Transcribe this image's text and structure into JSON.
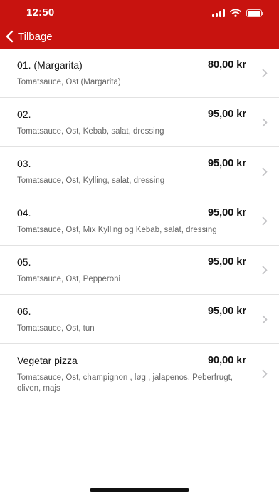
{
  "status": {
    "time": "12:50"
  },
  "nav": {
    "back_label": "Tilbage"
  },
  "items": [
    {
      "number": "01.  (Margarita)",
      "price": "80,00 kr",
      "description": "Tomatsauce, Ost (Margarita)"
    },
    {
      "number": "02.",
      "price": "95,00 kr",
      "description": "Tomatsauce, Ost, Kebab, salat, dressing"
    },
    {
      "number": "03.",
      "price": "95,00 kr",
      "description": "Tomatsauce, Ost, Kylling, salat, dressing"
    },
    {
      "number": "04.",
      "price": "95,00 kr",
      "description": "Tomatsauce, Ost, Mix Kylling og Kebab, salat, dressing"
    },
    {
      "number": "05.",
      "price": "95,00 kr",
      "description": "Tomatsauce, Ost, Pepperoni"
    },
    {
      "number": "06.",
      "price": "95,00 kr",
      "description": "Tomatsauce, Ost, tun"
    },
    {
      "number": "Vegetar pizza",
      "price": "90,00 kr",
      "description": "Tomatsauce, Ost, champignon , løg , jalapenos, Peberfrugt, oliven, majs"
    }
  ],
  "colors": {
    "header": "#c8130f",
    "divider": "#e2e2e2",
    "description": "#666666"
  }
}
